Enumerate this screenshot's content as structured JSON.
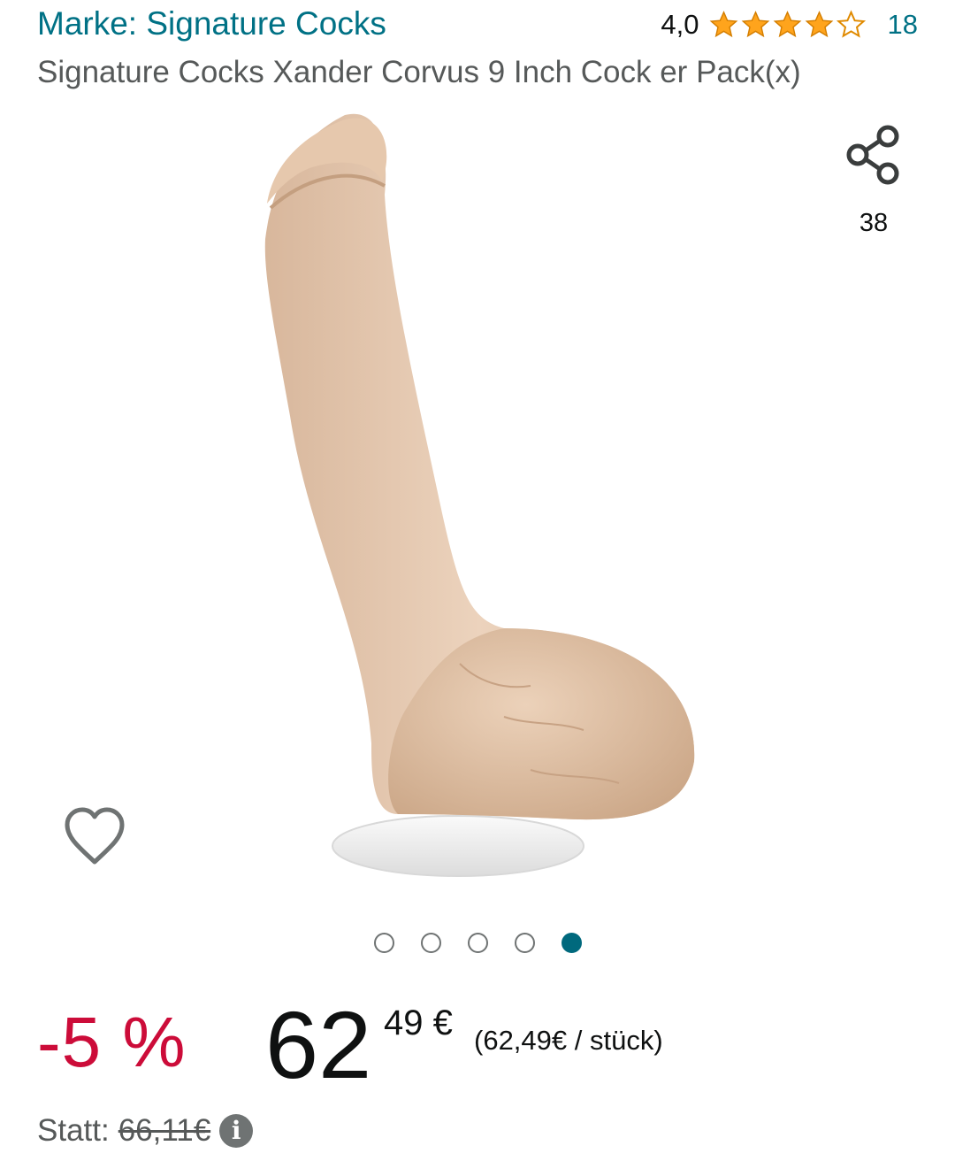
{
  "header": {
    "brand_label": "Marke: Signature Cocks",
    "rating_value": "4,0",
    "rating_stars": 4,
    "rating_max": 5,
    "rating_count": "18",
    "title": "Signature Cocks Xander Corvus 9 Inch Cock er Pack(x)"
  },
  "share": {
    "count": "38",
    "icon": "share-icon"
  },
  "wishlist": {
    "icon": "heart-outline-icon"
  },
  "gallery": {
    "total_images": 5,
    "active_index": 4
  },
  "price": {
    "discount": "-5 %",
    "whole": "62",
    "fraction": "49 €",
    "unit_price": "(62,49€ / stück)",
    "was_label": "Statt:",
    "was_amount": "66,11€"
  },
  "colors": {
    "link": "#007185",
    "discount": "#cc0c39",
    "star": "#ffa41c",
    "dot_active": "#00697d"
  }
}
